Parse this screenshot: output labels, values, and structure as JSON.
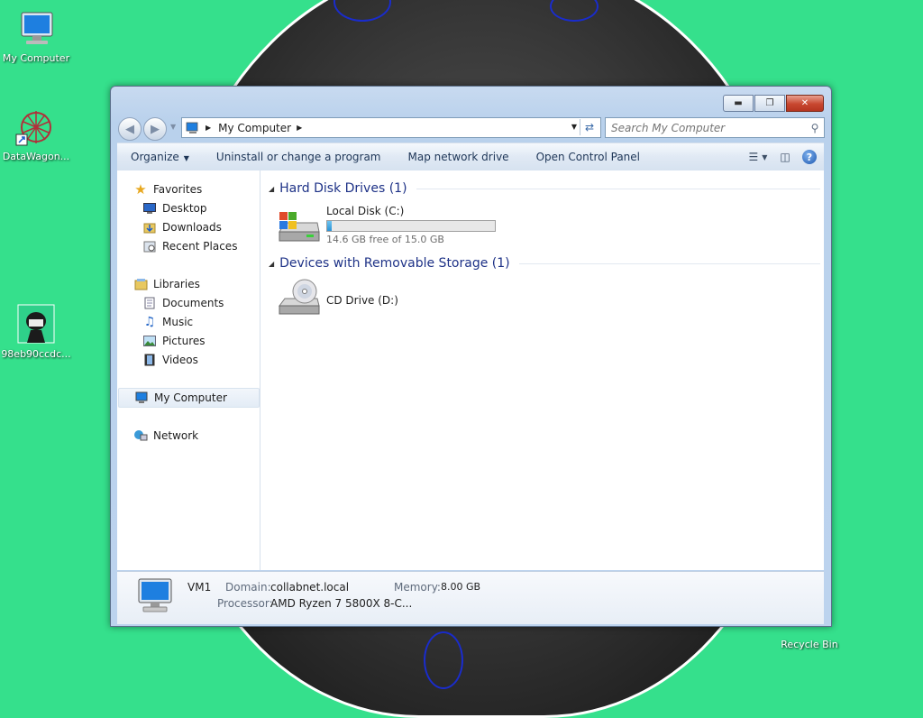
{
  "desktop": {
    "icons": [
      {
        "label": "My Computer"
      },
      {
        "label": "DataWagon..."
      },
      {
        "label": "98eb90ccdc..."
      },
      {
        "label": "Recycle Bin"
      }
    ]
  },
  "window": {
    "address": {
      "crumb": "My Computer"
    },
    "search": {
      "placeholder": "Search My Computer"
    },
    "commands": {
      "organize": "Organize",
      "uninstall": "Uninstall or change a program",
      "map_drive": "Map network drive",
      "control_panel": "Open Control Panel"
    },
    "nav": {
      "favorites": "Favorites",
      "desktop": "Desktop",
      "downloads": "Downloads",
      "recent": "Recent Places",
      "libraries": "Libraries",
      "documents": "Documents",
      "music": "Music",
      "pictures": "Pictures",
      "videos": "Videos",
      "my_computer": "My Computer",
      "network": "Network"
    },
    "groups": {
      "hdd": "Hard Disk Drives (1)",
      "removable": "Devices with Removable Storage (1)"
    },
    "drives": {
      "c_name": "Local Disk (C:)",
      "c_free": "14.6 GB free of 15.0 GB",
      "c_used_fraction": 0.027,
      "d_name": "CD Drive (D:)"
    },
    "details": {
      "computer_name": "VM1",
      "domain_label": "Domain:",
      "domain_value": "collabnet.local",
      "memory_label": "Memory:",
      "memory_value": "8.00 GB",
      "processor_label": "Processor:",
      "processor_value": "AMD Ryzen 7 5800X 8-C..."
    }
  },
  "colors": {
    "desktop_bg": "#35e08c",
    "link_text": "#1e3287",
    "close_button": "#c8472f"
  }
}
